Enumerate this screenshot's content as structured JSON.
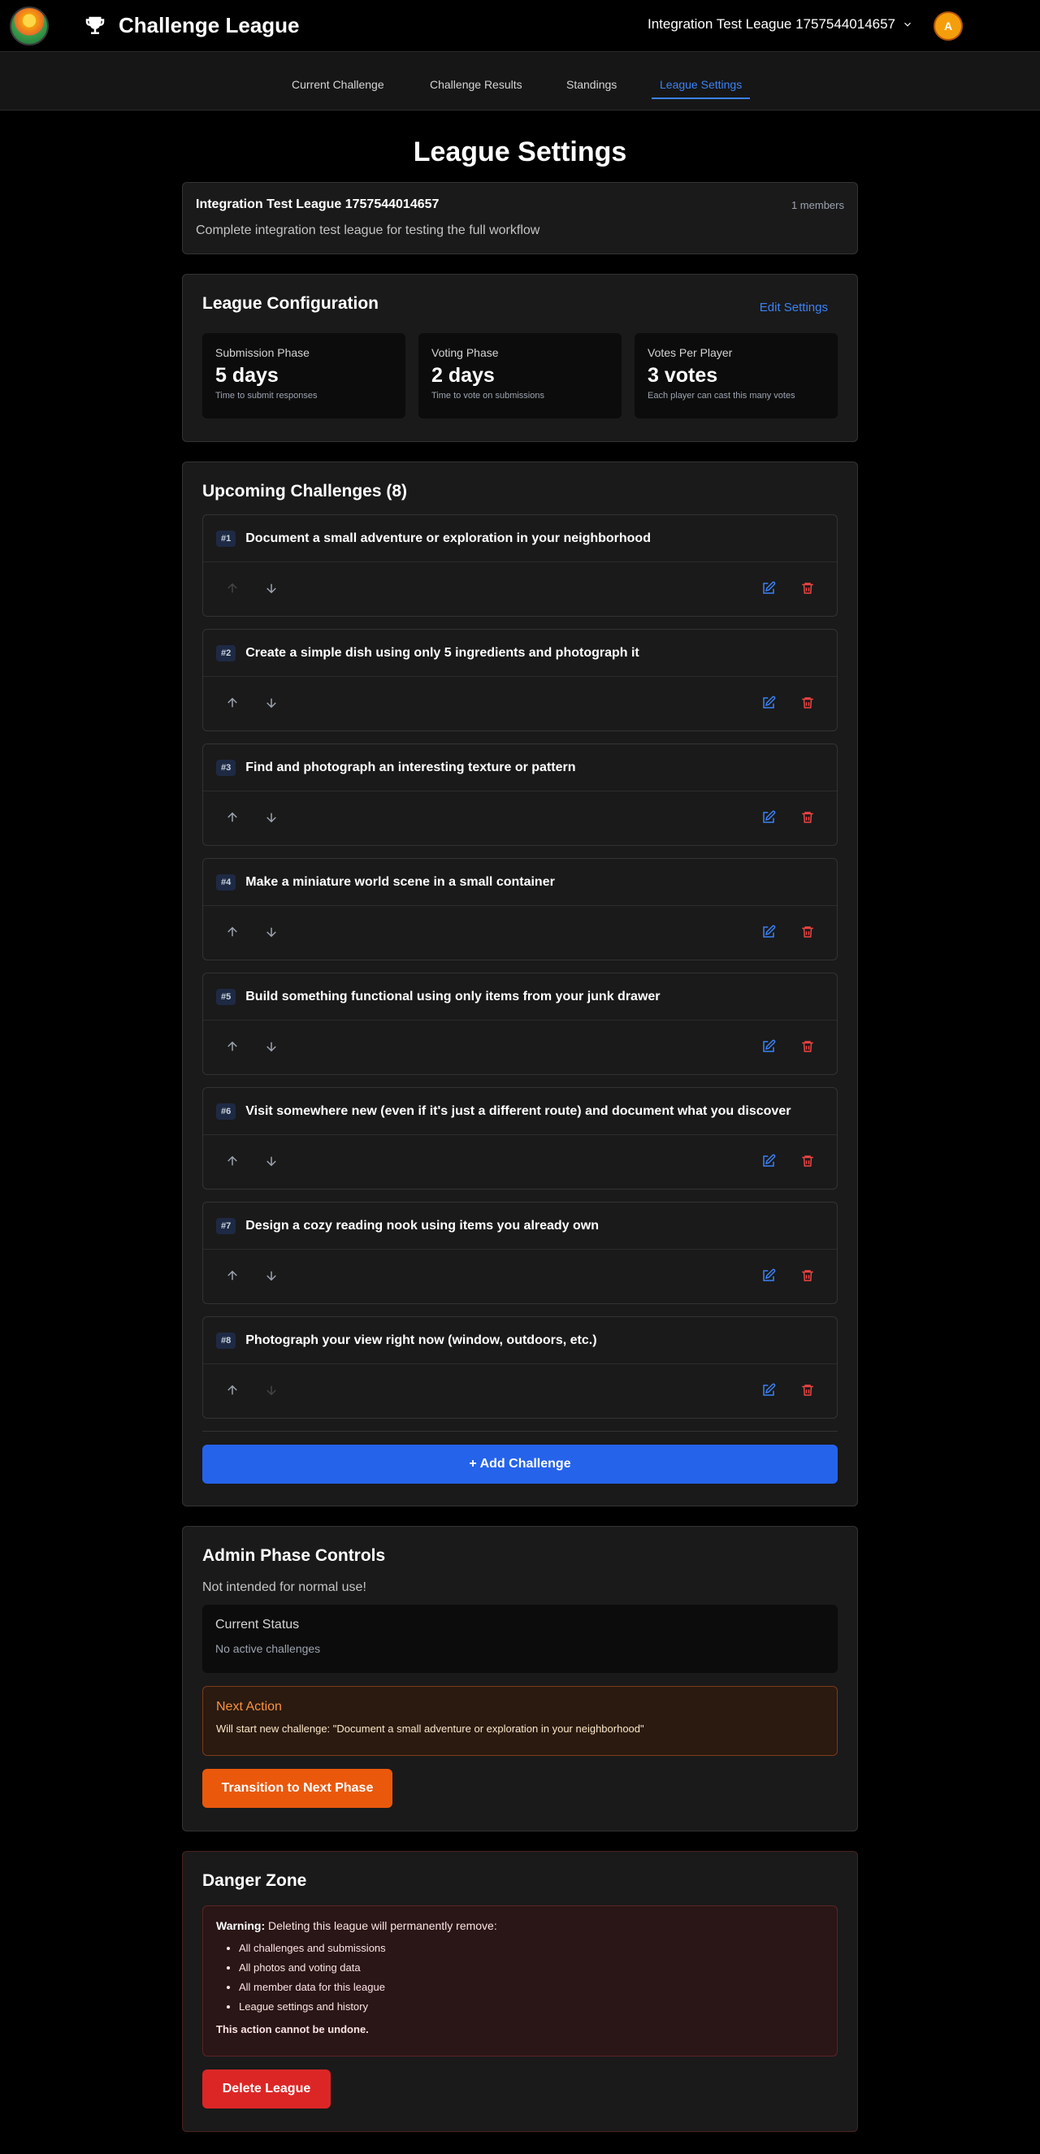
{
  "header": {
    "app_title": "Challenge League",
    "league_selector": "Integration Test League 1757544014657",
    "avatar_initial": "A"
  },
  "nav": {
    "tabs": [
      {
        "label": "Current Challenge"
      },
      {
        "label": "Challenge Results"
      },
      {
        "label": "Standings"
      },
      {
        "label": "League Settings"
      }
    ],
    "active": "League Settings"
  },
  "page": {
    "title": "League Settings"
  },
  "league": {
    "name": "Integration Test League 1757544014657",
    "members": "1 members",
    "description": "Complete integration test league for testing the full workflow"
  },
  "config": {
    "title": "League Configuration",
    "edit_label": "Edit Settings",
    "stats": [
      {
        "label": "Submission Phase",
        "value": "5 days",
        "sub": "Time to submit responses"
      },
      {
        "label": "Voting Phase",
        "value": "2 days",
        "sub": "Time to vote on submissions"
      },
      {
        "label": "Votes Per Player",
        "value": "3 votes",
        "sub": "Each player can cast this many votes"
      }
    ]
  },
  "upcoming": {
    "title": "Upcoming Challenges (8)",
    "challenges": [
      {
        "num": "#1",
        "text": "Document a small adventure or exploration in your neighborhood"
      },
      {
        "num": "#2",
        "text": "Create a simple dish using only 5 ingredients and photograph it"
      },
      {
        "num": "#3",
        "text": "Find and photograph an interesting texture or pattern"
      },
      {
        "num": "#4",
        "text": "Make a miniature world scene in a small container"
      },
      {
        "num": "#5",
        "text": "Build something functional using only items from your junk drawer"
      },
      {
        "num": "#6",
        "text": "Visit somewhere new (even if it's just a different route) and document what you discover"
      },
      {
        "num": "#7",
        "text": "Design a cozy reading nook using items you already own"
      },
      {
        "num": "#8",
        "text": "Photograph your view right now (window, outdoors, etc.)"
      }
    ],
    "add_label": "+ Add Challenge"
  },
  "admin": {
    "title": "Admin Phase Controls",
    "note": "Not intended for normal use!",
    "status_title": "Current Status",
    "status_text": "No active challenges",
    "next_title": "Next Action",
    "next_text": "Will start new challenge: \"Document a small adventure or exploration in your neighborhood\"",
    "transition_label": "Transition to Next Phase"
  },
  "danger": {
    "title": "Danger Zone",
    "warning_bold": "Warning:",
    "warning_text": " Deleting this league will permanently remove:",
    "items": [
      "All challenges and submissions",
      "All photos and voting data",
      "All member data for this league",
      "League settings and history"
    ],
    "final": "This action cannot be undone.",
    "delete_label": "Delete League"
  },
  "colors": {
    "accent": "#3b82f6",
    "primary_button": "#2563eb",
    "orange_button": "#ea580c",
    "danger_button": "#dc2626",
    "edit_icon": "#3b82f6",
    "delete_icon": "#ef4444"
  }
}
